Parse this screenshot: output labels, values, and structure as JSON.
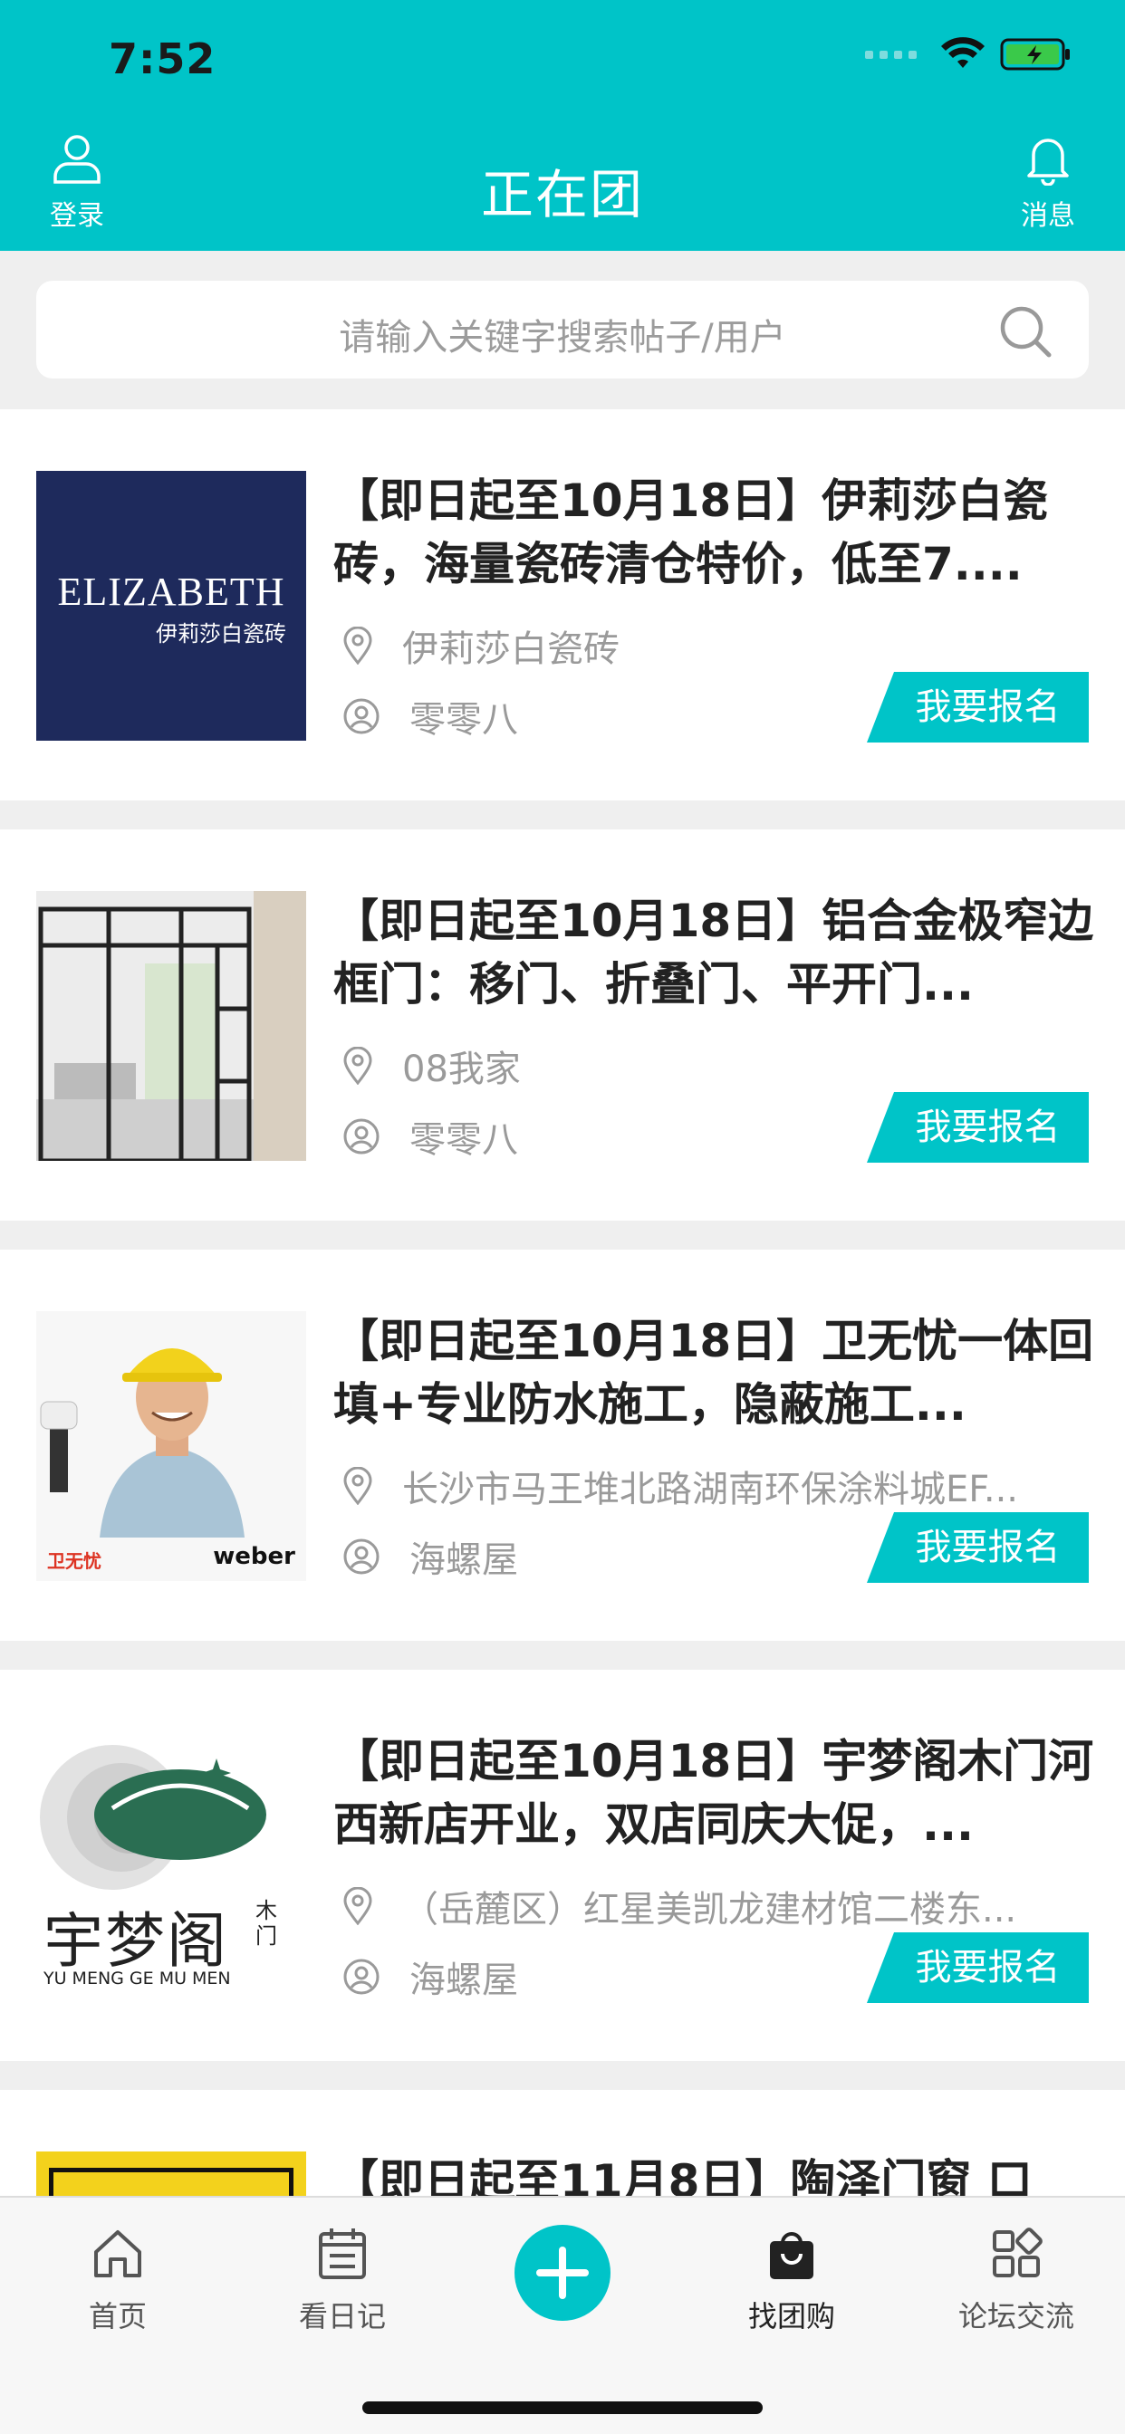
{
  "status": {
    "time": "7:52"
  },
  "header": {
    "title": "正在团",
    "login_label": "登录",
    "message_label": "消息"
  },
  "search": {
    "placeholder": "请输入关键字搜索帖子/用户"
  },
  "signup_label": "我要报名",
  "items": [
    {
      "title": "【即日起至10月18日】伊莉莎白瓷砖，海量瓷砖清仓特价，低至7....",
      "location": "伊莉莎白瓷砖",
      "user": "零零八",
      "logo_main": "ELIZABETH",
      "logo_sub": "伊莉莎白瓷砖"
    },
    {
      "title": "【即日起至10月18日】铝合金极窄边框门：移门、折叠门、平开门...",
      "location": "08我家",
      "user": "零零八"
    },
    {
      "title": "【即日起至10月18日】卫无忧一体回填+专业防水施工，隐蔽施工...",
      "location": "长沙市马王堆北路湖南环保涂料城EF...",
      "user": "海螺屋",
      "logo_left": "卫无忧",
      "logo_right": "weber"
    },
    {
      "title": "【即日起至10月18日】宇梦阁木门河西新店开业，双店同庆大促，...",
      "location": "（岳麓区）红星美凯龙建材馆二楼东...",
      "user": "海螺屋",
      "logo_cn": "宇梦阁",
      "logo_side": "木门",
      "logo_en": "YU MENG GE MU MEN"
    },
    {
      "title": "【即日起至11月8日】陶泽门窗 口"
    }
  ],
  "tabs": [
    {
      "label": "首页"
    },
    {
      "label": "看日记"
    },
    {
      "label": "找团购"
    },
    {
      "label": "论坛交流"
    }
  ],
  "colors": {
    "accent": "#00c4c8",
    "title_text": "#222222",
    "meta_text": "#9a9a9a"
  },
  "icons": [
    "user-icon",
    "bell-icon",
    "search-icon",
    "location-pin-icon",
    "user-circle-icon",
    "home-icon",
    "calendar-icon",
    "plus-icon",
    "shopping-bag-icon",
    "grid-icon"
  ]
}
